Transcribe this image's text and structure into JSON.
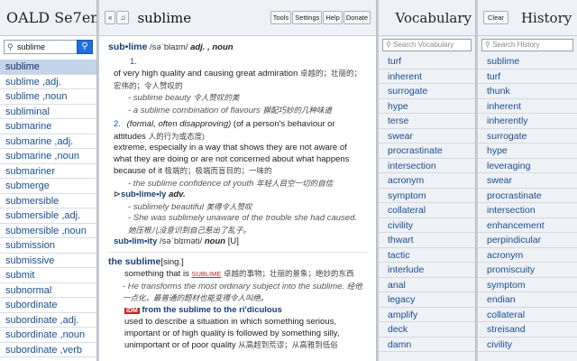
{
  "app": {
    "title": "OALD Se7en"
  },
  "search": {
    "value": "sublime"
  },
  "wordlist": [
    "sublime",
    "sublime ,adj.",
    "sublime ,noun",
    "subliminal",
    "submarine",
    "submarine ,adj.",
    "submarine ,noun",
    "submariner",
    "submerge",
    "submersible",
    "submersible ,adj.",
    "submersible ,noun",
    "submission",
    "submissive",
    "submit",
    "subnormal",
    "subordinate",
    "subordinate ,adj.",
    "subordinate ,noun",
    "subordinate ,verb"
  ],
  "toolbar": {
    "minus_label": "«",
    "sound_label": "♫",
    "headword": "sublime",
    "tools": "Tools",
    "settings": "Settings",
    "help": "Help",
    "donate": "Donate"
  },
  "entry": {
    "headword": "sub•lime",
    "pron": "/səˈblaɪm/",
    "pos": "adj. , noun",
    "sense1_num": "1.",
    "sense1_def": "of very high quality and causing great admiration",
    "sense1_zh": "卓越的；壮丽的；宏伟的；令人赞叹的",
    "ex1": "- sublime beauty",
    "ex1_zh": "令人赞叹的美",
    "ex2": "- a sublime combination of flavours",
    "ex2_zh": "摒配巧妙的几种味道",
    "sense2_num": "2.",
    "sense2_label": "(formal, often disapproving)",
    "sense2_note": "(of a person's behaviour or attitudes",
    "sense2_note_zh": "人的行为或态度)",
    "sense2_def": "extreme, especially in a way that shows they are not aware of what they are doing or are not concerned about what happens because of it",
    "sense2_zh": "极端的；极端而盲目的；一味的",
    "ex3": "- the sublime confidence of youth",
    "ex3_zh": "年轻人目空一切的自信",
    "deriv1_marker": "⊳",
    "deriv1": "sub•lime•ly",
    "deriv1_pos": "adv.",
    "ex4": "- sublimely beautiful",
    "ex4_zh": "美得令人赞叹",
    "ex5": "- She was sublimely unaware of the trouble she had caused.",
    "ex5_zh": "她压根儿没意识到自己惹出了乱子。",
    "deriv2": "sub•lim•ity",
    "deriv2_pron": "/səˈblɪməti/",
    "deriv2_pos": "noun",
    "deriv2_tag": "[U]",
    "noun_hw": "the sublime",
    "noun_tag": "[sing.]",
    "noun_def": "something that is",
    "noun_caps": "SUBLIME",
    "noun_zh": "卓越的事物；壮丽的景象；绝妙的东西",
    "ex6": "- He transforms the most ordinary subject into the sublime.",
    "ex6_zh": "经他一点化，最普通的题材也能变得令人叫绝。",
    "idm_tag": "IDM",
    "idm": "from the sublime to the ri'diculous",
    "idm_def": "used to describe a situation in which something serious, important or of high quality is followed by something silly, unimportant or of poor quality",
    "idm_zh": "从高超到荒谬；从高雅到低俗"
  },
  "vocabulary": {
    "title": "Vocabulary",
    "placeholder": "Search Vocabulary",
    "items": [
      "turf",
      "inherent",
      "surrogate",
      "hype",
      "terse",
      "swear",
      "procrastinate",
      "intersection",
      "acronym",
      "symptom",
      "collateral",
      "civility",
      "thwart",
      "tactic",
      "interlude",
      "anal",
      "legacy",
      "amplify",
      "deck",
      "damn"
    ]
  },
  "history": {
    "title": "History",
    "clear": "Clear",
    "placeholder": "Search History",
    "items": [
      "sublime",
      "turf",
      "thunk",
      "inherent",
      "inherently",
      "surrogate",
      "hype",
      "leveraging",
      "swear",
      "procrastinate",
      "intersection",
      "enhancement",
      "perpindicular",
      "acronym",
      "promiscuity",
      "symptom",
      "endian",
      "collateral",
      "streisand",
      "civility"
    ]
  }
}
